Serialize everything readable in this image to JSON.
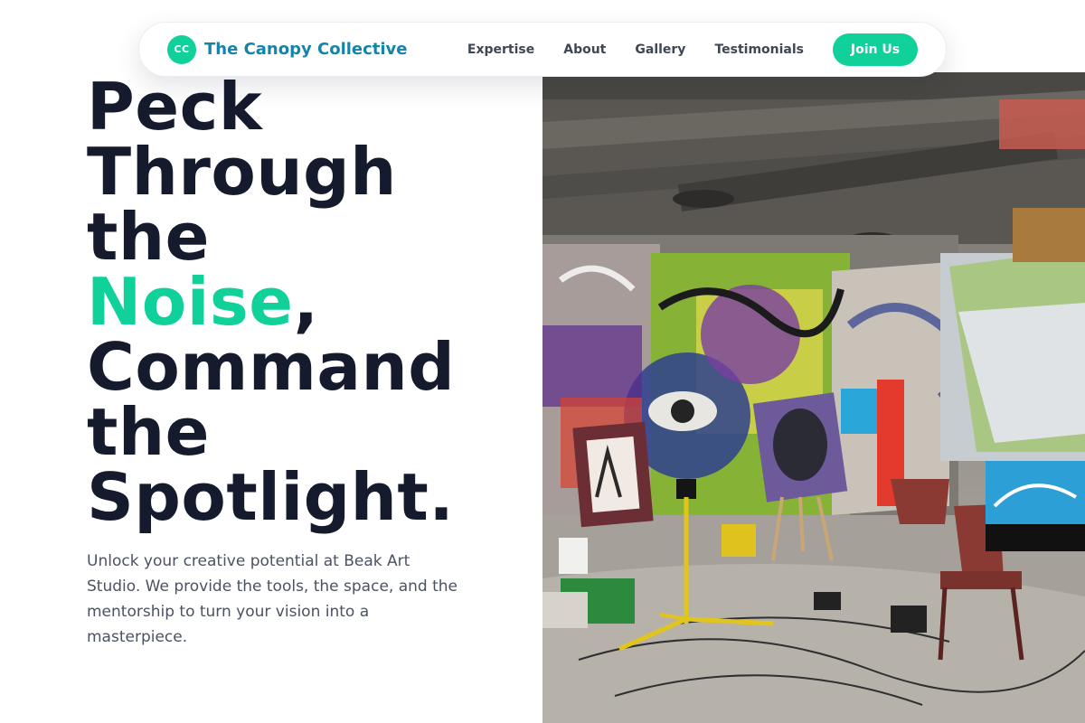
{
  "nav": {
    "brand_initials": "CC",
    "brand_name": "The Canopy Collective",
    "links": [
      "Expertise",
      "About",
      "Gallery",
      "Testimonials"
    ],
    "cta_label": "Join Us"
  },
  "hero": {
    "headline": {
      "line1": "Peck",
      "line2": "Through",
      "line3": "the",
      "accent_word": "Noise",
      "accent_punct": ",",
      "line5": "Command",
      "line6": "the",
      "line7": "Spotlight."
    },
    "description": "Unlock your creative potential at Beak Art Studio. We provide the tools, the space, and the mentorship to turn your vision into a masterpiece."
  },
  "colors": {
    "accent": "#10d19a",
    "brand_text": "#1683a8",
    "headline": "#151a2d"
  }
}
